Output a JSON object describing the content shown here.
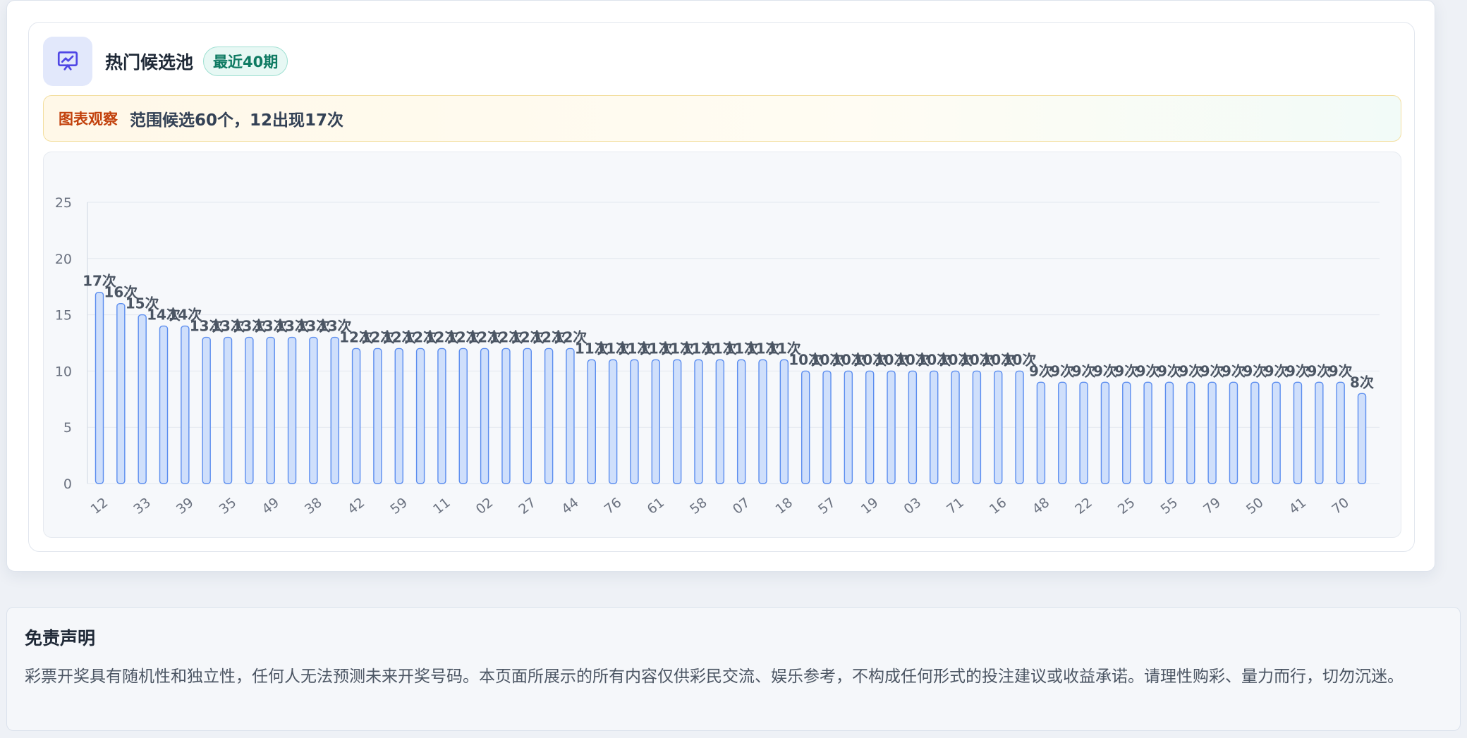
{
  "header": {
    "title": "热门候选池",
    "badge": "最近40期",
    "icon": "presentation-chart-icon"
  },
  "observation": {
    "label": "图表观察",
    "text": "范围候选60个，12出现17次"
  },
  "chart_data": {
    "type": "bar",
    "ylim": [
      0,
      25
    ],
    "yticks": [
      0,
      5,
      10,
      15,
      20,
      25
    ],
    "value_suffix": "次",
    "categories": [
      "12",
      "",
      "33",
      "",
      "39",
      "",
      "35",
      "",
      "49",
      "",
      "38",
      "",
      "42",
      "",
      "59",
      "",
      "11",
      "",
      "02",
      "",
      "27",
      "",
      "44",
      "",
      "76",
      "",
      "61",
      "",
      "58",
      "",
      "07",
      "",
      "18",
      "",
      "57",
      "",
      "19",
      "",
      "03",
      "",
      "71",
      "",
      "16",
      "",
      "48",
      "",
      "22",
      "",
      "25",
      "",
      "55",
      "",
      "79",
      "",
      "50",
      "",
      "41",
      "",
      "70",
      ""
    ],
    "values": [
      17,
      16,
      15,
      14,
      14,
      13,
      13,
      13,
      13,
      13,
      13,
      13,
      12,
      12,
      12,
      12,
      12,
      12,
      12,
      12,
      12,
      12,
      12,
      11,
      11,
      11,
      11,
      11,
      11,
      11,
      11,
      11,
      11,
      10,
      10,
      10,
      10,
      10,
      10,
      10,
      10,
      10,
      10,
      10,
      9,
      9,
      9,
      9,
      9,
      9,
      9,
      9,
      9,
      9,
      9,
      9,
      9,
      9,
      9,
      8
    ],
    "colors": {
      "bar_fill": "#cfdffb",
      "bar_stroke": "#5b8def",
      "label": "#4b5563",
      "grid": "#e3e8ef",
      "tick": "#6b7280"
    }
  },
  "disclaimer": {
    "title": "免责声明",
    "text": "彩票开奖具有随机性和独立性，任何人无法预测未来开奖号码。本页面所展示的所有内容仅供彩民交流、娱乐参考，不构成任何形式的投注建议或收益承诺。请理性购彩、量力而行，切勿沉迷。"
  }
}
